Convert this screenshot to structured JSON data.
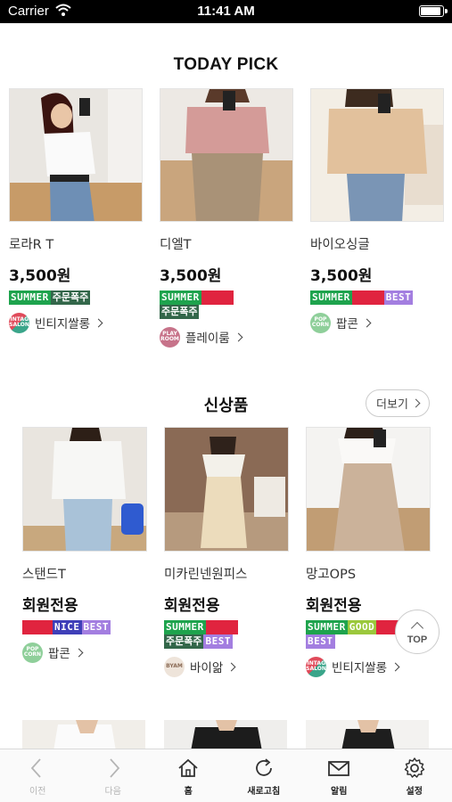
{
  "status_bar": {
    "carrier": "Carrier",
    "time": "11:41 AM"
  },
  "today_pick": {
    "title": "TODAY PICK",
    "items": [
      {
        "name": "로라R T",
        "price": "3,500원",
        "tags": [
          "SUMMER",
          "주문폭주"
        ],
        "shop": "빈티지쌀롱"
      },
      {
        "name": "디엘T",
        "price": "3,500원",
        "tags": [
          "SUMMER",
          "",
          "주문폭주"
        ],
        "shop": "플레이룸"
      },
      {
        "name": "바이오싱글",
        "price": "3,500원",
        "tags": [
          "SUMMER",
          "",
          "BEST"
        ],
        "shop": "팝콘"
      }
    ]
  },
  "new_items": {
    "title": "신상품",
    "more_label": "더보기",
    "items": [
      {
        "name": "스탠드T",
        "price": "회원전용",
        "tags": [
          "",
          "NICE",
          "BEST"
        ],
        "shop": "팝콘"
      },
      {
        "name": "미카린넨원피스",
        "price": "회원전용",
        "tags": [
          "SUMMER",
          "",
          "주문폭주",
          "BEST"
        ],
        "shop": "바이앎"
      },
      {
        "name": "망고OPS",
        "price": "회원전용",
        "tags": [
          "SUMMER",
          "GOOD",
          "",
          "BEST"
        ],
        "shop": "빈티지쌀롱"
      }
    ]
  },
  "shop_logos": {
    "vintage": "VINTAGE SALON",
    "popcorn": "POP CORN",
    "playroom": "PLAY ROOM",
    "byam": "BYAM"
  },
  "top_button": "TOP",
  "tabbar": [
    {
      "label": "이전",
      "icon": "chevron-left-icon"
    },
    {
      "label": "다음",
      "icon": "chevron-right-icon"
    },
    {
      "label": "홈",
      "icon": "home-icon"
    },
    {
      "label": "새로고침",
      "icon": "refresh-icon"
    },
    {
      "label": "알림",
      "icon": "mail-icon"
    },
    {
      "label": "설정",
      "icon": "gear-icon"
    }
  ]
}
